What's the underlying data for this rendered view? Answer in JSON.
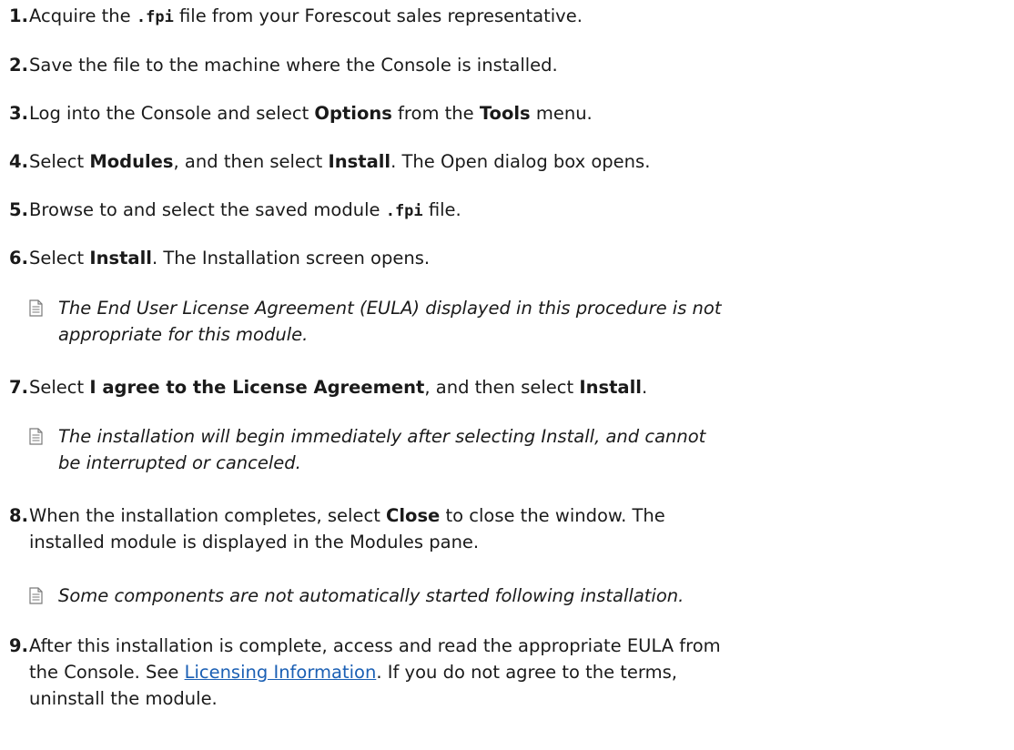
{
  "steps": [
    {
      "number": "1.",
      "segments": [
        {
          "text": "Acquire the ",
          "style": "plain"
        },
        {
          "text": ".fpi",
          "style": "mono"
        },
        {
          "text": " file from your Forescout sales representative.",
          "style": "plain"
        }
      ]
    },
    {
      "number": "2.",
      "segments": [
        {
          "text": "Save the file to the machine where the Console is installed.",
          "style": "plain"
        }
      ]
    },
    {
      "number": "3.",
      "segments": [
        {
          "text": "Log into the Console and select ",
          "style": "plain"
        },
        {
          "text": "Options",
          "style": "bold"
        },
        {
          "text": " from the ",
          "style": "plain"
        },
        {
          "text": "Tools",
          "style": "bold"
        },
        {
          "text": " menu.",
          "style": "plain"
        }
      ]
    },
    {
      "number": "4.",
      "segments": [
        {
          "text": "Select ",
          "style": "plain"
        },
        {
          "text": "Modules",
          "style": "bold"
        },
        {
          "text": ", and then select ",
          "style": "plain"
        },
        {
          "text": "Install",
          "style": "bold"
        },
        {
          "text": ". The Open dialog box opens.",
          "style": "plain"
        }
      ]
    },
    {
      "number": "5.",
      "segments": [
        {
          "text": "Browse to and select the saved module ",
          "style": "plain"
        },
        {
          "text": ".fpi",
          "style": "mono"
        },
        {
          "text": " file.",
          "style": "plain"
        }
      ]
    },
    {
      "number": "6.",
      "segments": [
        {
          "text": "Select ",
          "style": "plain"
        },
        {
          "text": "Install",
          "style": "bold"
        },
        {
          "text": ". The Installation screen opens.",
          "style": "plain"
        }
      ]
    },
    {
      "number": "7.",
      "segments": [
        {
          "text": "Select ",
          "style": "plain"
        },
        {
          "text": "I agree to the License Agreement",
          "style": "bold"
        },
        {
          "text": ", and then select ",
          "style": "plain"
        },
        {
          "text": "Install",
          "style": "bold"
        },
        {
          "text": ".",
          "style": "plain"
        }
      ]
    },
    {
      "number": "8.",
      "segments": [
        {
          "text": "When the installation completes, select ",
          "style": "plain"
        },
        {
          "text": "Close",
          "style": "bold"
        },
        {
          "text": " to close the window. The",
          "style": "plain"
        },
        {
          "text": "\n",
          "style": "break"
        },
        {
          "text": "installed module is displayed in the Modules pane.",
          "style": "plain"
        }
      ]
    },
    {
      "number": "9.",
      "segments": [
        {
          "text": "After this installation is complete, access and read the appropriate EULA from",
          "style": "plain"
        },
        {
          "text": "\n",
          "style": "break"
        },
        {
          "text": "the Console. See ",
          "style": "plain"
        },
        {
          "text": "Licensing Information",
          "style": "link"
        },
        {
          "text": ". If you do not agree to the terms,",
          "style": "plain"
        },
        {
          "text": "\n",
          "style": "break"
        },
        {
          "text": "uninstall the module.",
          "style": "plain"
        }
      ]
    }
  ],
  "notes": [
    {
      "after_step": "6.",
      "icon": "note-icon",
      "lines": [
        "The End User License Agreement (EULA) displayed in this procedure is not",
        "appropriate for this module."
      ]
    },
    {
      "after_step": "7.",
      "icon": "note-icon",
      "lines": [
        "The installation will begin immediately after selecting Install, and cannot",
        "be interrupted or canceled."
      ]
    },
    {
      "after_step": "8.",
      "icon": "note-icon",
      "lines": [
        "Some components are not automatically started following installation."
      ]
    }
  ],
  "colors": {
    "text": "#1a1a1a",
    "link": "#1a5fb4",
    "note_icon": "#7a7a7a"
  }
}
